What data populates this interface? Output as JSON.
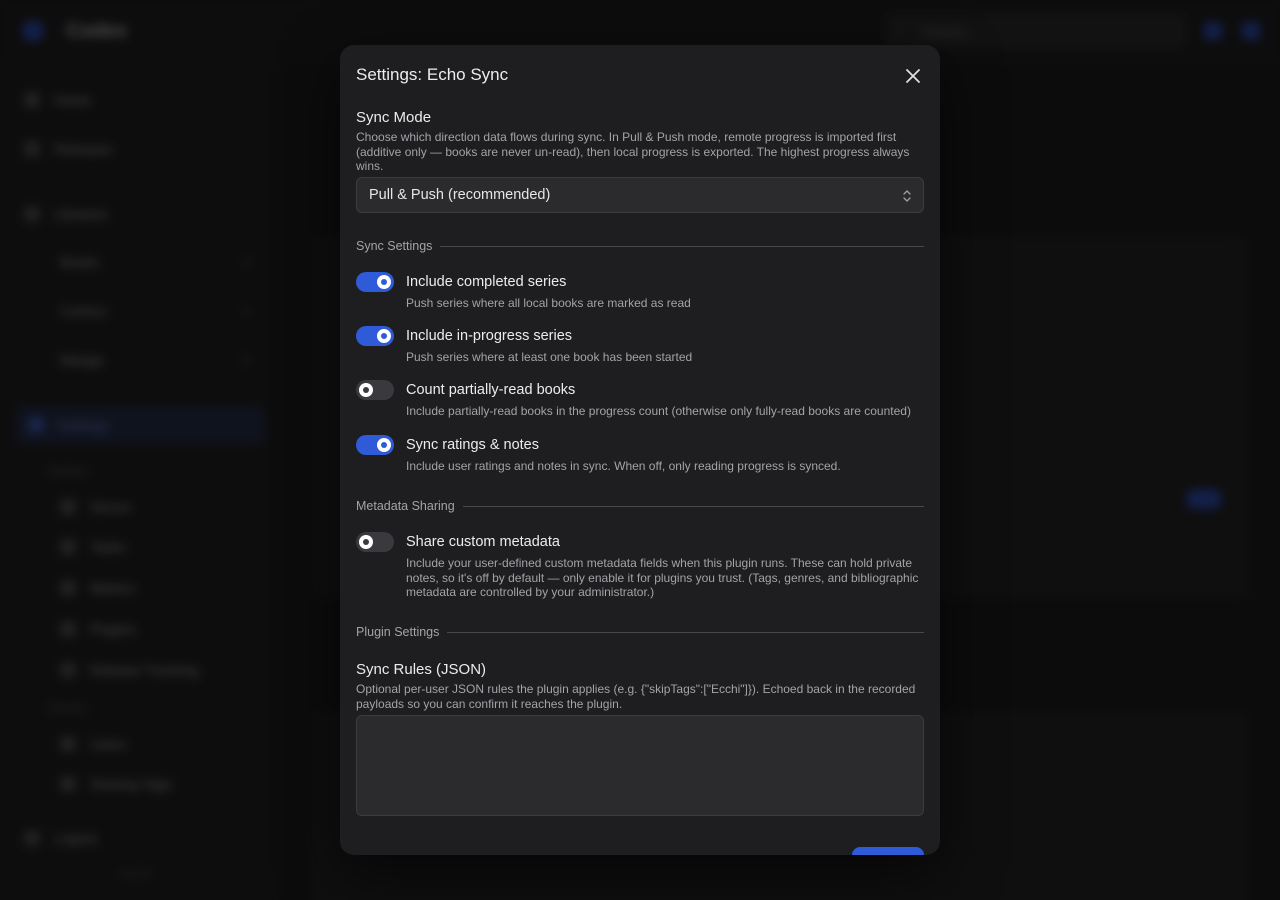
{
  "background": {
    "app_title": "Codex",
    "search_placeholder": "Search...",
    "nav": {
      "home": "Home",
      "releases": "Releases",
      "libraries": "Libraries",
      "library_items": [
        {
          "label": "Books",
          "count": "1"
        },
        {
          "label": "Comics",
          "count": "1"
        },
        {
          "label": "Manga",
          "count": "1"
        }
      ],
      "settings": "Settings",
      "system_section": "System",
      "system_items": [
        "Server",
        "Tasks",
        "Metrics",
        "Plugins",
        "Release Tracking"
      ],
      "access_section": "Access",
      "access_items": [
        "Users",
        "Sharing Tags"
      ],
      "logout": "Logout",
      "version": "v1.0.0"
    }
  },
  "modal": {
    "title": "Settings: Echo Sync",
    "sync_mode": {
      "label": "Sync Mode",
      "description": "Choose which direction data flows during sync. In Pull & Push mode, remote progress is imported first (additive only — books are never un-read), then local progress is exported. The highest progress always wins.",
      "selected": "Pull & Push (recommended)"
    },
    "sync_settings": {
      "heading": "Sync Settings",
      "options": [
        {
          "label": "Include completed series",
          "description": "Push series where all local books are marked as read",
          "enabled": true
        },
        {
          "label": "Include in-progress series",
          "description": "Push series where at least one book has been started",
          "enabled": true
        },
        {
          "label": "Count partially-read books",
          "description": "Include partially-read books in the progress count (otherwise only fully-read books are counted)",
          "enabled": false
        },
        {
          "label": "Sync ratings & notes",
          "description": "Include user ratings and notes in sync. When off, only reading progress is synced.",
          "enabled": true
        }
      ]
    },
    "metadata_sharing": {
      "heading": "Metadata Sharing",
      "options": [
        {
          "label": "Share custom metadata",
          "description": "Include your user-defined custom metadata fields when this plugin runs. These can hold private notes, so it's off by default — only enable it for plugins you trust. (Tags, genres, and bibliographic metadata are controlled by your administrator.)",
          "enabled": false
        }
      ]
    },
    "plugin_settings": {
      "heading": "Plugin Settings",
      "sync_rules": {
        "label": "Sync Rules (JSON)",
        "description": "Optional per-user JSON rules the plugin applies (e.g. {\"skipTags\":[\"Ecchi\"]}). Echoed back in the recorded payloads so you can confirm it reaches the plugin.",
        "value": ""
      }
    }
  },
  "colors": {
    "accent": "#2f5ad8",
    "modal_bg": "#1e1e20",
    "page_bg": "#131314"
  }
}
